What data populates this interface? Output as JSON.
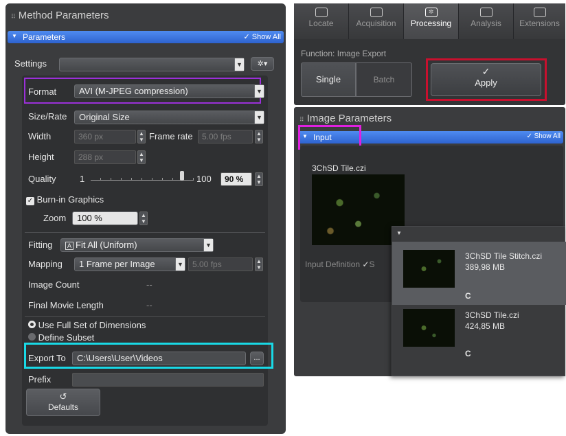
{
  "method": {
    "title": "Method Parameters",
    "parameters_label": "Parameters",
    "show_all": "Show All",
    "settings_label": "Settings",
    "format_label": "Format",
    "format_value": "AVI (M-JPEG compression)",
    "size_rate_label": "Size/Rate",
    "size_rate_value": "Original Size",
    "width_label": "Width",
    "width_value": "360 px",
    "frame_rate_label": "Frame rate",
    "frame_rate_value": "5.00 fps",
    "height_label": "Height",
    "height_value": "288 px",
    "quality_label": "Quality",
    "quality_min": "1",
    "quality_max": "100",
    "quality_value": "90 %",
    "quality_slider_fraction": 0.9,
    "burn_in_label": "Burn-in Graphics",
    "zoom_label": "Zoom",
    "zoom_value": "100 %",
    "fitting_label": "Fitting",
    "fitting_value": "Fit All (Uniform)",
    "mapping_label": "Mapping",
    "mapping_value": "1 Frame per Image",
    "mapping_fps": "5.00 fps",
    "image_count_label": "Image Count",
    "image_count_value": "--",
    "movie_length_label": "Final Movie Length",
    "movie_length_value": "--",
    "full_set_label": "Use Full Set of Dimensions",
    "subset_label": "Define Subset",
    "export_label": "Export To",
    "export_value": "C:\\Users\\User\\Videos",
    "browse_label": "...",
    "prefix_label": "Prefix",
    "prefix_value": "",
    "defaults_label": "Defaults"
  },
  "tabs": [
    {
      "label": "Locate",
      "icon": "locate-icon"
    },
    {
      "label": "Acquisition",
      "icon": "acquisition-icon"
    },
    {
      "label": "Processing",
      "icon": "processing-icon"
    },
    {
      "label": "Analysis",
      "icon": "analysis-icon"
    },
    {
      "label": "Extensions",
      "icon": "extensions-icon"
    }
  ],
  "function_label": "Function:",
  "function_value": "Image Export",
  "single_label": "Single",
  "batch_label": "Batch",
  "apply_label": "Apply",
  "image_params": {
    "title": "Image Parameters",
    "input_label": "Input",
    "show_all": "Show All",
    "file_name": "3ChSD Tile.czi",
    "input_definition_label": "Input Definition",
    "input_definition_partial": "S",
    "dropdown": [
      {
        "name": "3ChSD Tile Stitch.czi",
        "size": "389,98 MB",
        "tag": "C"
      },
      {
        "name": "3ChSD Tile.czi",
        "size": "424,85 MB",
        "tag": "C"
      }
    ]
  },
  "colors": {
    "format_highlight": "#9b30d9",
    "apply_highlight": "#c8102e",
    "input_highlight": "#e020e0",
    "export_highlight": "#19d9e6",
    "accent_blue": "#3a72e0"
  }
}
